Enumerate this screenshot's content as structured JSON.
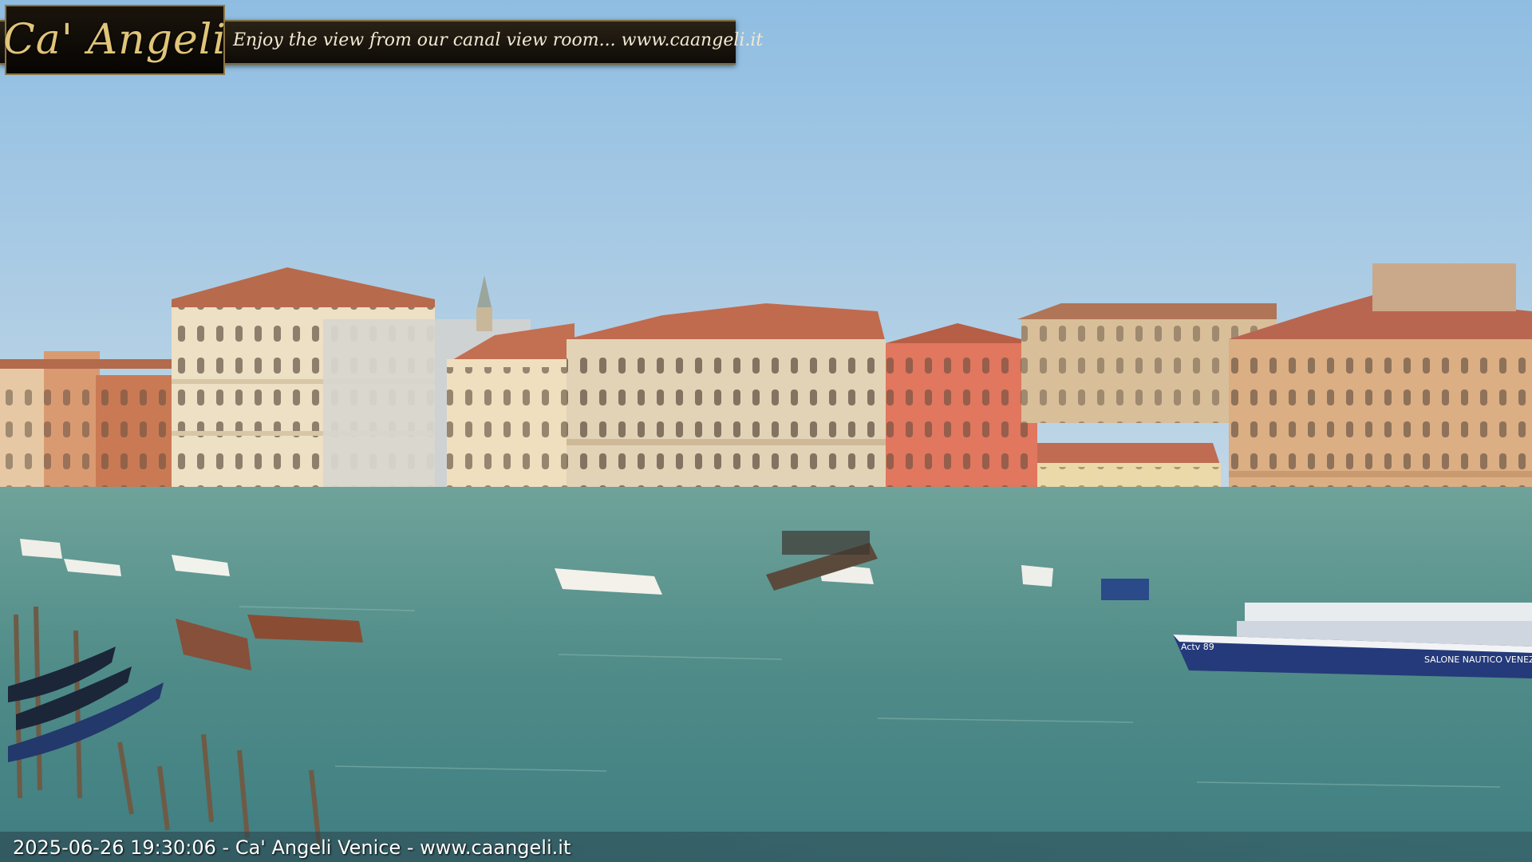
{
  "logo": {
    "text": "Ca' Angeli"
  },
  "banner": {
    "tagline": "Enjoy the view from our canal view room... www.caangeli.it"
  },
  "overlay": {
    "timestamp": "2025-06-26 19:30:06 - Ca' Angeli Venice - www.caangeli.it"
  },
  "vaporetto": {
    "label": "SALONE NAUTICO VENEZIA",
    "line": "Actv 89"
  },
  "colors": {
    "sky": "#a8c9e3",
    "water": "#4e8f8a",
    "brick": "#d6735a",
    "stone": "#e3d2b2"
  }
}
